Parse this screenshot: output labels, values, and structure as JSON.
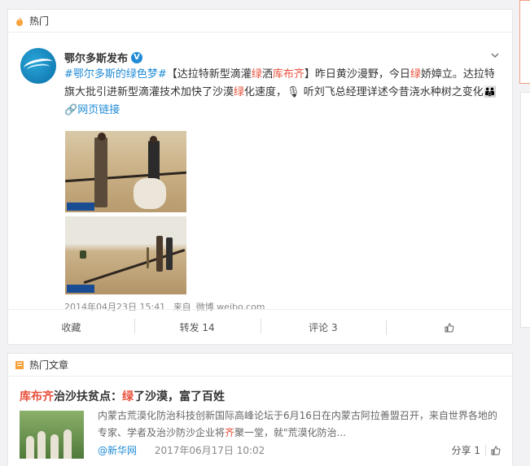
{
  "hot_header": {
    "label": "热门"
  },
  "post": {
    "author": "鄂尔多斯发布",
    "verified_mark": "V",
    "topic": "#鄂尔多斯的绿色梦#",
    "text_1": "【达拉特新型滴灌",
    "text_green1": "绿",
    "text_2": "洒",
    "text_place": "库布齐",
    "text_3": "】昨日黄沙漫野，今日",
    "text_green2": "绿",
    "text_4": "娇嫜立。达拉特旗大批引进新型滴灌技术加快了沙漠",
    "text_green3": "绿",
    "text_5": "化速度，",
    "text_6": " 听刘飞总经理详述今昔浇水种树之变化",
    "web_link": "网页链接",
    "date": "2014年04月23日 15:41",
    "source_prefix": "来自",
    "source": "微博 weibo.com"
  },
  "actions": {
    "favorite": "收藏",
    "repost": "转发 14",
    "comment": "评论 3"
  },
  "article_header": {
    "label": "热门文章"
  },
  "article": {
    "title_red": "库布齐",
    "title_1": "治沙扶贫点：",
    "title_red2": "绿",
    "title_2": "了沙漠，富了百姓",
    "excerpt_1": "内蒙古荒漠化防治科技创新国际高峰论坛于6月16日在内蒙古阿拉善盟召开，来自世界各地的专家、学者及治沙防沙企业将",
    "excerpt_red": "齐",
    "excerpt_2": "聚一堂，就\"荒漠化防治...",
    "source": "@新华网",
    "date": "2017年06月17日 10:02",
    "share": "分享 1"
  }
}
